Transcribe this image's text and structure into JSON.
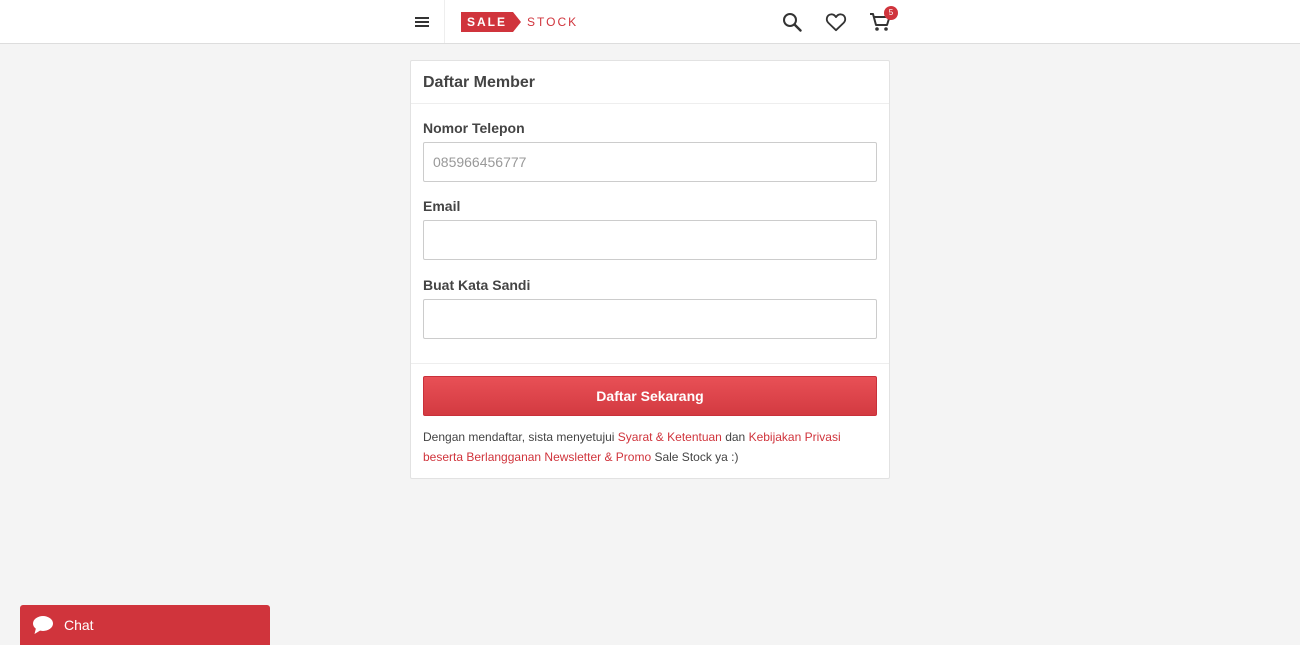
{
  "header": {
    "logo_sale": "SALE",
    "logo_stock": "STOCK",
    "cart_count": "5",
    "icons": [
      "menu-icon",
      "search-icon",
      "heart-icon",
      "cart-icon"
    ]
  },
  "form": {
    "title": "Daftar Member",
    "phone_label": "Nomor Telepon",
    "phone_placeholder": "085966456777",
    "phone_value": "",
    "email_label": "Email",
    "email_value": "",
    "password_label": "Buat Kata Sandi",
    "password_value": "",
    "submit_label": "Daftar Sekarang"
  },
  "terms": {
    "prefix": "Dengan mendaftar, sista menyetujui ",
    "terms_link": "Syarat & Ketentuan",
    "middle": " dan ",
    "privacy_link": "Kebijakan Privasi beserta Berlangganan Newsletter & Promo",
    "suffix": " Sale Stock ya :)"
  },
  "chat": {
    "label": "Chat",
    "icon": "chat-bubble-icon"
  },
  "colors": {
    "accent": "#d0343c",
    "background": "#f4f4f4",
    "text": "#444444"
  }
}
